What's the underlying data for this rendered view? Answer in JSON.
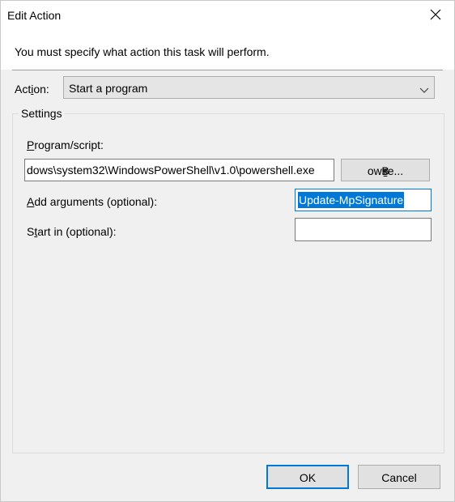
{
  "window": {
    "title": "Edit Action"
  },
  "instruction": "You must specify what action this task will perform.",
  "action": {
    "label_pre": "Act",
    "label_ul": "i",
    "label_post": "on:",
    "selected": "Start a program"
  },
  "settings": {
    "group_title": "Settings",
    "program": {
      "label_ul": "P",
      "label_post": "rogram/script:",
      "value": "dows\\system32\\WindowsPowerShell\\v1.0\\powershell.exe"
    },
    "browse": {
      "pre": "B",
      "ul": "r",
      "post": "owse..."
    },
    "arguments": {
      "label_ul": "A",
      "label_post": "dd arguments (optional):",
      "value": "Update-MpSignature"
    },
    "start_in": {
      "label_pre": "S",
      "label_ul": "t",
      "label_post": "art in (optional):",
      "value": ""
    }
  },
  "buttons": {
    "ok": "OK",
    "cancel": "Cancel"
  },
  "icons": {
    "close": "close-icon",
    "dropdown": "chevron-down-icon"
  },
  "colors": {
    "accent": "#0078d7",
    "dialog_bg": "#f0f0f0"
  }
}
